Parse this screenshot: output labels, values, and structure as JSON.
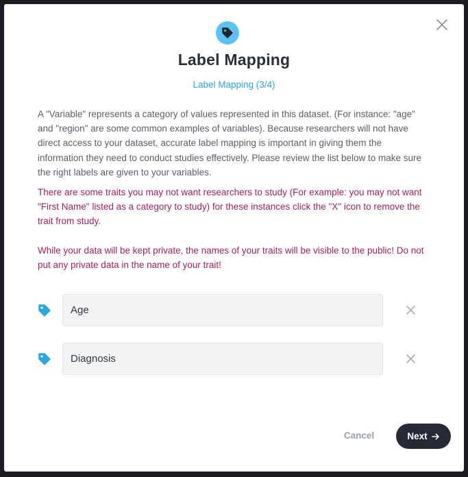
{
  "modal": {
    "title": "Label Mapping",
    "step": "Label Mapping (3/4)",
    "description": "A \"Variable\" represents a category of values represented in this dataset. (For instance: \"age\" and \"region\" are some common examples of variables). Because researchers will not have direct access to your dataset, accurate label mapping is important in giving them the information they need to conduct studies effectively. Please review the list below to make sure the right labels are given to your variables.",
    "warning_1": "There are some traits you may not want researchers to study (For example: you may not want \"First Name\" listed as a category to study) for these instances click the \"X\" icon to remove the trait from study.",
    "warning_2": "While your data will be kept private, the names of your traits will be visible to the public! Do not put any private data in the name of your trait!",
    "header_icon": "tag-icon",
    "close_icon": "close-icon"
  },
  "traits": [
    {
      "value": "Age",
      "icon": "tag-icon"
    },
    {
      "value": "Diagnosis",
      "icon": "tag-icon"
    }
  ],
  "footer": {
    "cancel_label": "Cancel",
    "next_label": "Next",
    "next_icon": "arrow-right-icon"
  },
  "colors": {
    "accent": "#2aa6d6",
    "header_icon_bg": "#5cc2ef",
    "warning": "#a11f63",
    "primary_button": "#262a35"
  }
}
